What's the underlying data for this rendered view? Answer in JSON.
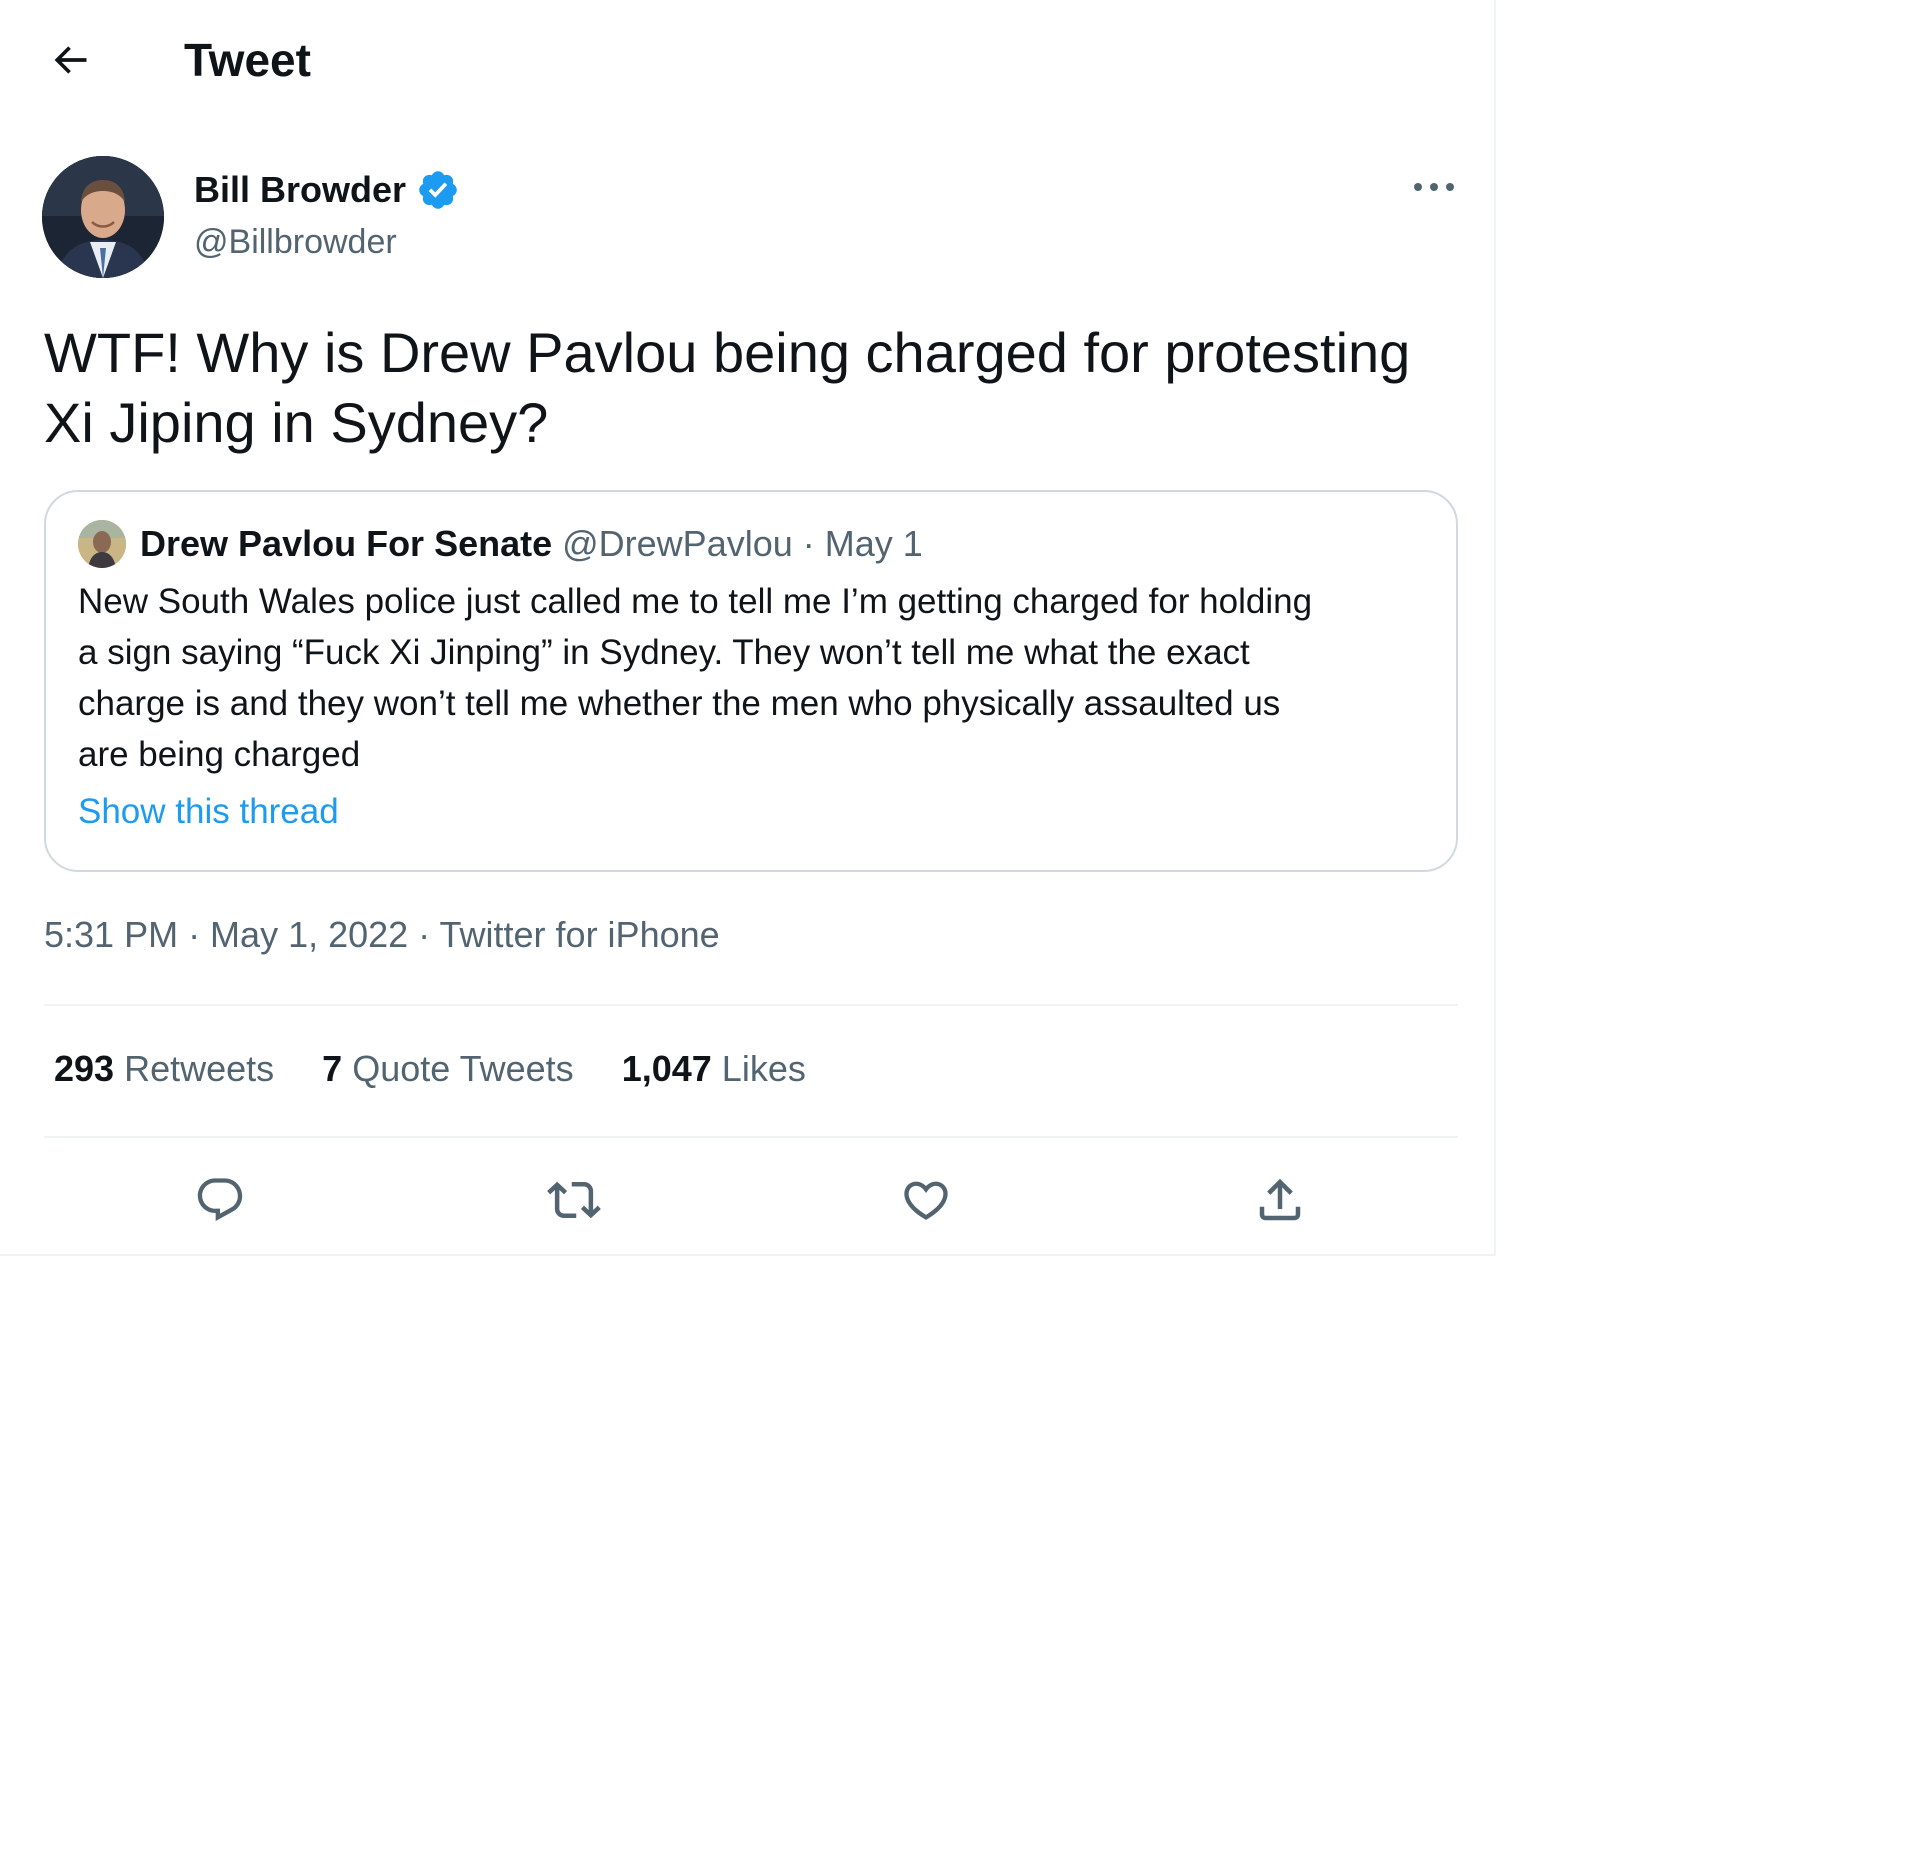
{
  "header": {
    "title": "Tweet",
    "back_icon": "arrow-left-icon"
  },
  "author": {
    "name": "Bill Browder",
    "handle": "@Billbrowder",
    "verified": true,
    "avatar_icon": "avatar"
  },
  "tweet": {
    "text_line1": "WTF! Why is Drew Pavlou being charged for protesting",
    "text_line2": "Xi Jiping in Sydney?",
    "timestamp": "5:31 PM · May 1, 2022 · Twitter for iPhone"
  },
  "quote": {
    "name": "Drew Pavlou For Senate",
    "handle": "@DrewPavlou",
    "date": "· May 1",
    "text_lines": [
      "New South Wales police just called me to tell me I’m getting charged for holding",
      "a sign saying “Fuck Xi Jinping” in Sydney. They won’t tell me what the exact",
      "charge is and they won’t tell me whether the men who physically assaulted us",
      "are being charged"
    ],
    "link": "Show this thread"
  },
  "stats": [
    {
      "num": "293",
      "label": "Retweets"
    },
    {
      "num": "7",
      "label": "Quote Tweets"
    },
    {
      "num": "1,047",
      "label": "Likes"
    }
  ],
  "actions": [
    "reply-icon",
    "retweet-icon",
    "like-icon",
    "share-icon"
  ],
  "colors": {
    "text": "#0f1419",
    "secondary": "#536471",
    "accent": "#1d9bf0",
    "border": "#cfd9de"
  }
}
